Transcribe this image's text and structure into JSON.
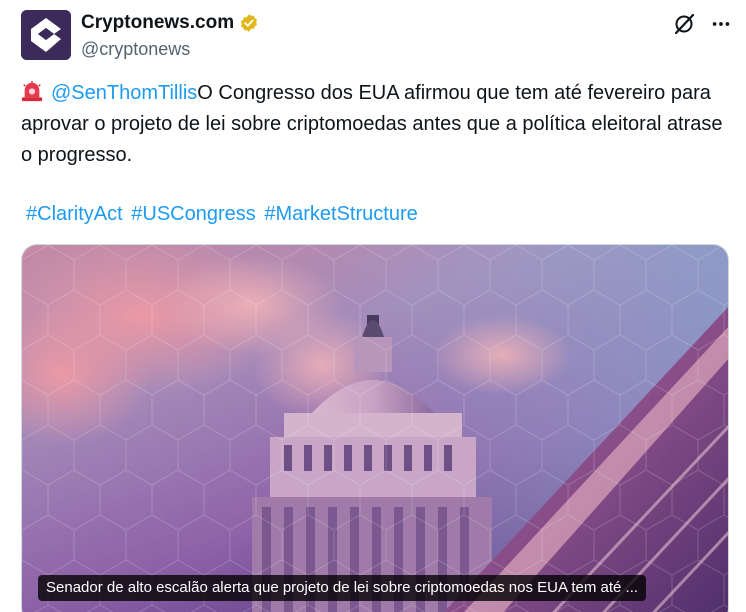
{
  "author": {
    "display_name": "Cryptonews.com",
    "handle": "@cryptonews",
    "avatar_icon": "cryptonews-logo-icon",
    "verified_icon": "gold-verified-badge-icon",
    "verified_color": "#e2b719"
  },
  "actions": {
    "grok_icon": "grok-icon",
    "more_icon": "more-options-icon"
  },
  "tweet": {
    "emoji": "police-siren-icon",
    "mention": "@SenThomTillis",
    "body": "O Congresso dos EUA afirmou que tem até fevereiro para aprovar o projeto de lei sobre criptomoedas antes que a política eleitoral atrase o progresso.",
    "hashtags": [
      "#ClarityAct",
      "#USCongress",
      "#MarketStructure"
    ]
  },
  "media": {
    "caption": "Senador de alto escalão alerta que projeto de lei sobre criptomoedas nos EUA tem até ..."
  },
  "colors": {
    "link": "#1d9bf0",
    "text": "#0f1419",
    "muted": "#536471"
  }
}
